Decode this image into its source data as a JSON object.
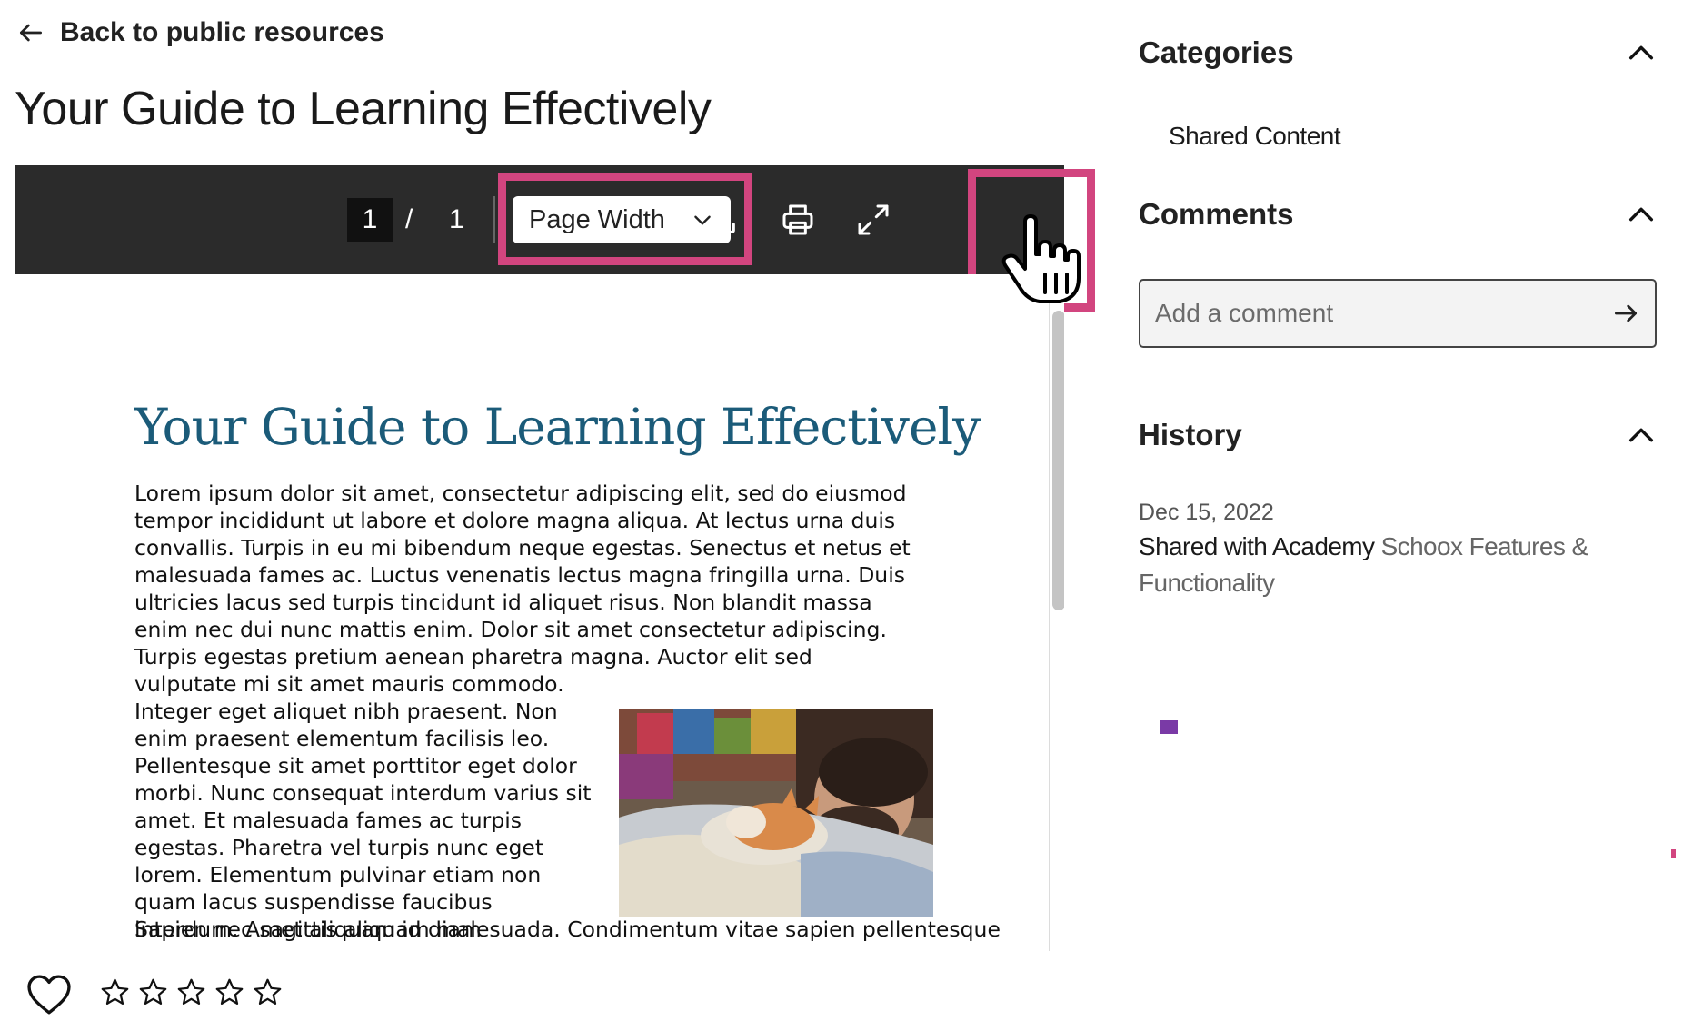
{
  "back_link": {
    "label": "Back to public resources",
    "icon": "arrow-left-icon"
  },
  "page_title": "Your Guide to Learning Effectively",
  "viewer": {
    "toolbar": {
      "current_page": "1",
      "separator": "/",
      "total_pages": "1",
      "zoom": {
        "selected": "Page Width",
        "icon": "chevron-down-icon"
      },
      "download_icon": "download-icon",
      "print_icon": "printer-icon",
      "fullscreen_icon": "expand-icon"
    },
    "document": {
      "heading": "Your Guide to Learning Effectively",
      "paragraph_1": "Lorem ipsum dolor sit amet, consectetur adipiscing elit, sed do eiusmod tempor incididunt ut labore et dolore magna aliqua. At lectus urna duis convallis. Turpis in eu mi bibendum neque egestas. Senectus et netus et malesuada fames ac. Luctus venenatis lectus magna fringilla urna. Duis ultricies lacus sed turpis tincidunt id aliquet risus. Non blandit massa enim nec dui nunc mattis enim. Dolor sit amet consectetur adipiscing. Turpis egestas pretium aenean pharetra magna. Auctor elit sed vulputate mi sit amet mauris commodo.",
      "paragraph_2": "Integer eget aliquet nibh praesent. Non enim praesent elementum facilisis leo. Pellentesque sit amet porttitor eget dolor morbi. Nunc consequat interdum varius sit amet. Et malesuada fames ac turpis egestas. Pharetra vel turpis nunc eget lorem. Elementum pulvinar etiam non quam lacus suspendisse faucibus interdum. Amet aliquam id diam maecenas.",
      "paragraph_3": "Sapien nec sagittis aliquam malesuada. Condimentum vitae sapien pellentesque"
    }
  },
  "reactions": {
    "heart_icon": "heart-outline-icon",
    "star_icon": "star-outline-icon",
    "rating": 0,
    "max_rating": 5
  },
  "sidebar": {
    "categories": {
      "title": "Categories",
      "items": [
        "Shared Content"
      ]
    },
    "comments": {
      "title": "Comments",
      "placeholder": "Add a comment",
      "value": "",
      "send_icon": "arrow-right-icon"
    },
    "history": {
      "title": "History",
      "entries": [
        {
          "date": "Dec 15, 2022",
          "action": "Shared with Academy",
          "target": "Schoox Features & Functionality"
        }
      ]
    }
  },
  "colors": {
    "highlight": "#d2457f",
    "toolbar_bg": "#2b2b2b",
    "doc_heading": "#1b5b79",
    "accent_purple": "#7a3aa6"
  }
}
